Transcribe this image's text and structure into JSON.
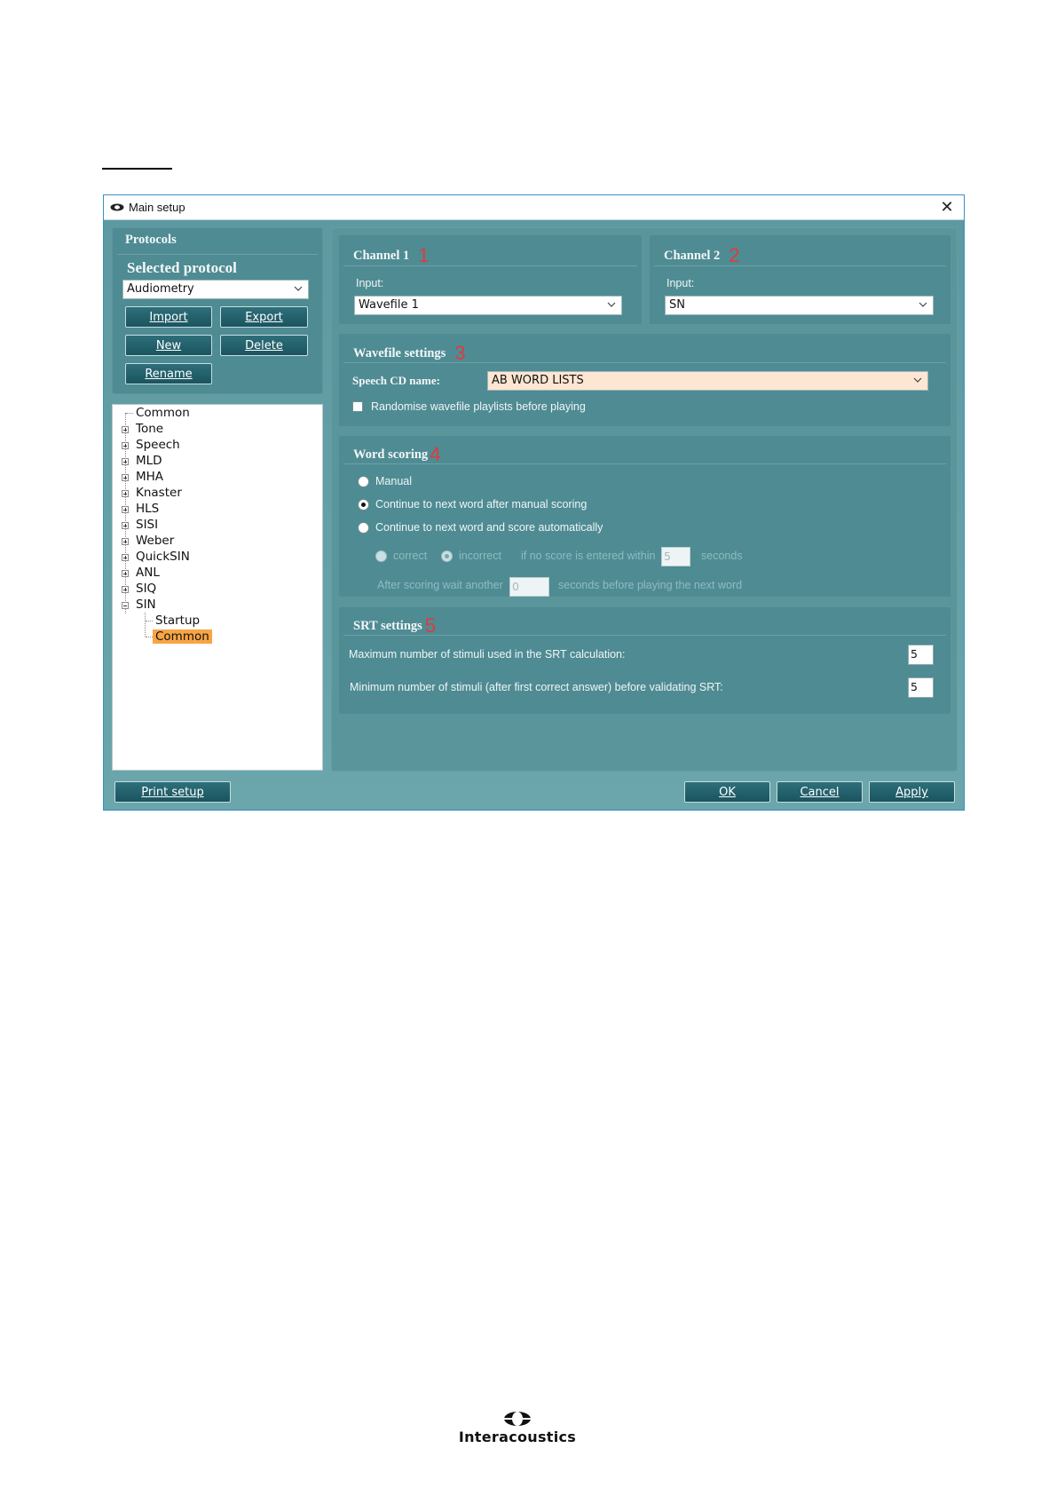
{
  "window": {
    "title": "Main setup",
    "close_label": "✕"
  },
  "protocols": {
    "header": "Protocols",
    "selected_label": "Selected protocol",
    "selected_value": "Audiometry",
    "buttons": {
      "import": "Import",
      "export": "Export",
      "new": "New",
      "delete": "Delete",
      "rename": "Rename"
    }
  },
  "tree": {
    "items": [
      "Common",
      "Tone",
      "Speech",
      "MLD",
      "MHA",
      "Knaster",
      "HLS",
      "SISI",
      "Weber",
      "QuickSIN",
      "ANL",
      "SIQ",
      "SIN"
    ],
    "sin_children": [
      "Startup",
      "Common"
    ],
    "selected": "Common"
  },
  "channel1": {
    "header": "Channel 1",
    "marker": "1",
    "input_label": "Input:",
    "input_value": "Wavefile 1"
  },
  "channel2": {
    "header": "Channel 2",
    "marker": "2",
    "input_label": "Input:",
    "input_value": "SN"
  },
  "wavefile": {
    "header": "Wavefile settings",
    "marker": "3",
    "cd_label": "Speech CD name:",
    "cd_value": "AB WORD LISTS",
    "randomise_label": "Randomise wavefile playlists before playing",
    "randomise_checked": false
  },
  "word_scoring": {
    "header": "Word scoring",
    "marker": "4",
    "options": [
      "Manual",
      "Continue to next word after manual scoring",
      "Continue to next word and score automatically"
    ],
    "selected_index": 1,
    "auto": {
      "correct": "correct",
      "incorrect": "incorrect",
      "if_no_score": "if no score is entered within",
      "seconds_value": "5",
      "seconds": "seconds",
      "after_scoring": "After scoring wait another",
      "wait_value": "0",
      "before_next": "seconds before playing the next word"
    }
  },
  "srt": {
    "header": "SRT settings",
    "marker": "5",
    "max_label": "Maximum number of stimuli used in the SRT calculation:",
    "max_value": "5",
    "min_label": "Minimum number of stimuli (after first correct answer) before validating SRT:",
    "min_value": "5"
  },
  "footer": {
    "print_setup": "Print setup",
    "ok": "OK",
    "cancel": "Cancel",
    "apply": "Apply"
  },
  "logo": {
    "text": "Interacoustics"
  },
  "colors": {
    "dialog_teal": "#5e9aa0",
    "panel_teal": "#4f8b93",
    "highlight": "#f7a545",
    "marker_red": "#e23a3a",
    "combo_highlight": "#fde6d2"
  }
}
